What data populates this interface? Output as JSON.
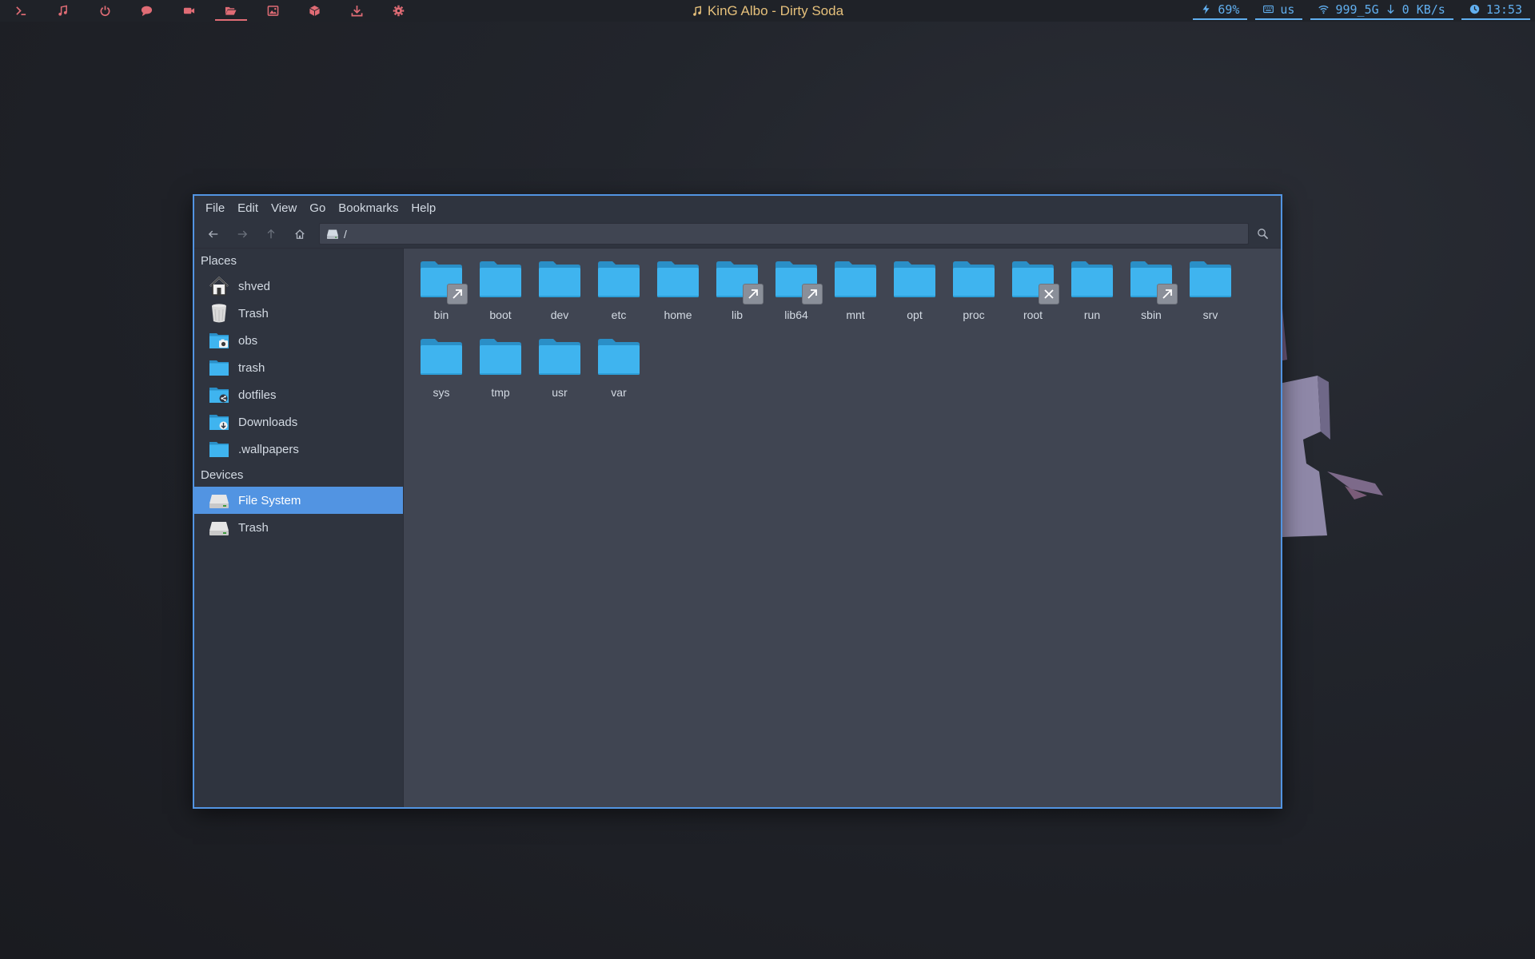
{
  "topbar": {
    "workspaces": [
      {
        "icon": "terminal-icon"
      },
      {
        "icon": "music-note-icon"
      },
      {
        "icon": "power-icon"
      },
      {
        "icon": "chat-bubble-icon"
      },
      {
        "icon": "video-camera-icon"
      },
      {
        "icon": "folder-open-icon",
        "active": true
      },
      {
        "icon": "image-icon"
      },
      {
        "icon": "cube-icon"
      },
      {
        "icon": "download-icon"
      },
      {
        "icon": "gear-icon"
      }
    ],
    "now_playing": "KinG Albo - Dirty Soda",
    "battery": "69%",
    "keyboard_layout": "us",
    "wifi_ssid": "999_5G",
    "net_speed": "0 KB/s",
    "clock": "13:53",
    "colors": {
      "workspace_icons": "#e06c75",
      "status": "#61afef",
      "now_playing": "#e5c07b"
    }
  },
  "window": {
    "menu": [
      "File",
      "Edit",
      "View",
      "Go",
      "Bookmarks",
      "Help"
    ],
    "location_path": "/",
    "sidebar": {
      "places_title": "Places",
      "places": [
        {
          "label": "shved",
          "icon": "home-icon"
        },
        {
          "label": "Trash",
          "icon": "trash-icon"
        },
        {
          "label": "obs",
          "icon": "folder-camera-icon"
        },
        {
          "label": "trash",
          "icon": "folder-icon"
        },
        {
          "label": "dotfiles",
          "icon": "folder-share-icon"
        },
        {
          "label": "Downloads",
          "icon": "folder-download-icon"
        },
        {
          "label": ".wallpapers",
          "icon": "folder-icon"
        }
      ],
      "devices_title": "Devices",
      "devices": [
        {
          "label": "File System",
          "icon": "drive-icon",
          "selected": true
        },
        {
          "label": "Trash",
          "icon": "drive-icon"
        }
      ]
    },
    "files": [
      {
        "name": "bin",
        "emblem": "link"
      },
      {
        "name": "boot"
      },
      {
        "name": "dev"
      },
      {
        "name": "etc"
      },
      {
        "name": "home"
      },
      {
        "name": "lib",
        "emblem": "link"
      },
      {
        "name": "lib64",
        "emblem": "link"
      },
      {
        "name": "mnt"
      },
      {
        "name": "opt"
      },
      {
        "name": "proc"
      },
      {
        "name": "root",
        "emblem": "locked"
      },
      {
        "name": "run"
      },
      {
        "name": "sbin",
        "emblem": "link"
      },
      {
        "name": "srv"
      },
      {
        "name": "sys"
      },
      {
        "name": "tmp"
      },
      {
        "name": "usr"
      },
      {
        "name": "var"
      }
    ],
    "colors": {
      "accent": "#5294e2",
      "folder": "#3fb4ef"
    }
  }
}
